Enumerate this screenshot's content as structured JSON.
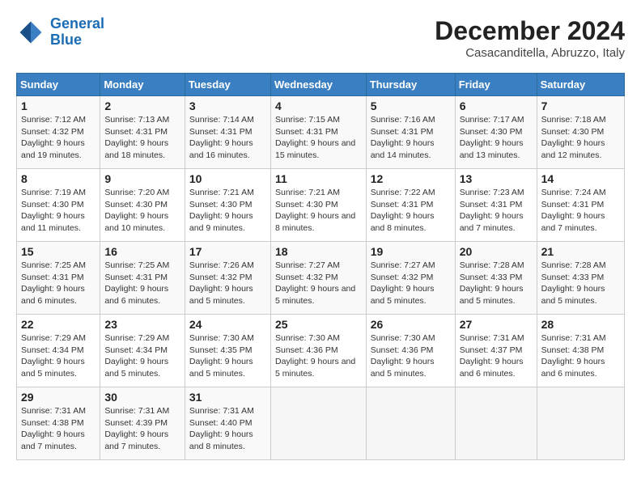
{
  "header": {
    "logo_line1": "General",
    "logo_line2": "Blue",
    "month": "December 2024",
    "location": "Casacanditella, Abruzzo, Italy"
  },
  "weekdays": [
    "Sunday",
    "Monday",
    "Tuesday",
    "Wednesday",
    "Thursday",
    "Friday",
    "Saturday"
  ],
  "weeks": [
    [
      {
        "day": 1,
        "info": "Sunrise: 7:12 AM\nSunset: 4:32 PM\nDaylight: 9 hours and 19 minutes."
      },
      {
        "day": 2,
        "info": "Sunrise: 7:13 AM\nSunset: 4:31 PM\nDaylight: 9 hours and 18 minutes."
      },
      {
        "day": 3,
        "info": "Sunrise: 7:14 AM\nSunset: 4:31 PM\nDaylight: 9 hours and 16 minutes."
      },
      {
        "day": 4,
        "info": "Sunrise: 7:15 AM\nSunset: 4:31 PM\nDaylight: 9 hours and 15 minutes."
      },
      {
        "day": 5,
        "info": "Sunrise: 7:16 AM\nSunset: 4:31 PM\nDaylight: 9 hours and 14 minutes."
      },
      {
        "day": 6,
        "info": "Sunrise: 7:17 AM\nSunset: 4:30 PM\nDaylight: 9 hours and 13 minutes."
      },
      {
        "day": 7,
        "info": "Sunrise: 7:18 AM\nSunset: 4:30 PM\nDaylight: 9 hours and 12 minutes."
      }
    ],
    [
      {
        "day": 8,
        "info": "Sunrise: 7:19 AM\nSunset: 4:30 PM\nDaylight: 9 hours and 11 minutes."
      },
      {
        "day": 9,
        "info": "Sunrise: 7:20 AM\nSunset: 4:30 PM\nDaylight: 9 hours and 10 minutes."
      },
      {
        "day": 10,
        "info": "Sunrise: 7:21 AM\nSunset: 4:30 PM\nDaylight: 9 hours and 9 minutes."
      },
      {
        "day": 11,
        "info": "Sunrise: 7:21 AM\nSunset: 4:30 PM\nDaylight: 9 hours and 8 minutes."
      },
      {
        "day": 12,
        "info": "Sunrise: 7:22 AM\nSunset: 4:31 PM\nDaylight: 9 hours and 8 minutes."
      },
      {
        "day": 13,
        "info": "Sunrise: 7:23 AM\nSunset: 4:31 PM\nDaylight: 9 hours and 7 minutes."
      },
      {
        "day": 14,
        "info": "Sunrise: 7:24 AM\nSunset: 4:31 PM\nDaylight: 9 hours and 7 minutes."
      }
    ],
    [
      {
        "day": 15,
        "info": "Sunrise: 7:25 AM\nSunset: 4:31 PM\nDaylight: 9 hours and 6 minutes."
      },
      {
        "day": 16,
        "info": "Sunrise: 7:25 AM\nSunset: 4:31 PM\nDaylight: 9 hours and 6 minutes."
      },
      {
        "day": 17,
        "info": "Sunrise: 7:26 AM\nSunset: 4:32 PM\nDaylight: 9 hours and 5 minutes."
      },
      {
        "day": 18,
        "info": "Sunrise: 7:27 AM\nSunset: 4:32 PM\nDaylight: 9 hours and 5 minutes."
      },
      {
        "day": 19,
        "info": "Sunrise: 7:27 AM\nSunset: 4:32 PM\nDaylight: 9 hours and 5 minutes."
      },
      {
        "day": 20,
        "info": "Sunrise: 7:28 AM\nSunset: 4:33 PM\nDaylight: 9 hours and 5 minutes."
      },
      {
        "day": 21,
        "info": "Sunrise: 7:28 AM\nSunset: 4:33 PM\nDaylight: 9 hours and 5 minutes."
      }
    ],
    [
      {
        "day": 22,
        "info": "Sunrise: 7:29 AM\nSunset: 4:34 PM\nDaylight: 9 hours and 5 minutes."
      },
      {
        "day": 23,
        "info": "Sunrise: 7:29 AM\nSunset: 4:34 PM\nDaylight: 9 hours and 5 minutes."
      },
      {
        "day": 24,
        "info": "Sunrise: 7:30 AM\nSunset: 4:35 PM\nDaylight: 9 hours and 5 minutes."
      },
      {
        "day": 25,
        "info": "Sunrise: 7:30 AM\nSunset: 4:36 PM\nDaylight: 9 hours and 5 minutes."
      },
      {
        "day": 26,
        "info": "Sunrise: 7:30 AM\nSunset: 4:36 PM\nDaylight: 9 hours and 5 minutes."
      },
      {
        "day": 27,
        "info": "Sunrise: 7:31 AM\nSunset: 4:37 PM\nDaylight: 9 hours and 6 minutes."
      },
      {
        "day": 28,
        "info": "Sunrise: 7:31 AM\nSunset: 4:38 PM\nDaylight: 9 hours and 6 minutes."
      }
    ],
    [
      {
        "day": 29,
        "info": "Sunrise: 7:31 AM\nSunset: 4:38 PM\nDaylight: 9 hours and 7 minutes."
      },
      {
        "day": 30,
        "info": "Sunrise: 7:31 AM\nSunset: 4:39 PM\nDaylight: 9 hours and 7 minutes."
      },
      {
        "day": 31,
        "info": "Sunrise: 7:31 AM\nSunset: 4:40 PM\nDaylight: 9 hours and 8 minutes."
      },
      null,
      null,
      null,
      null
    ]
  ]
}
